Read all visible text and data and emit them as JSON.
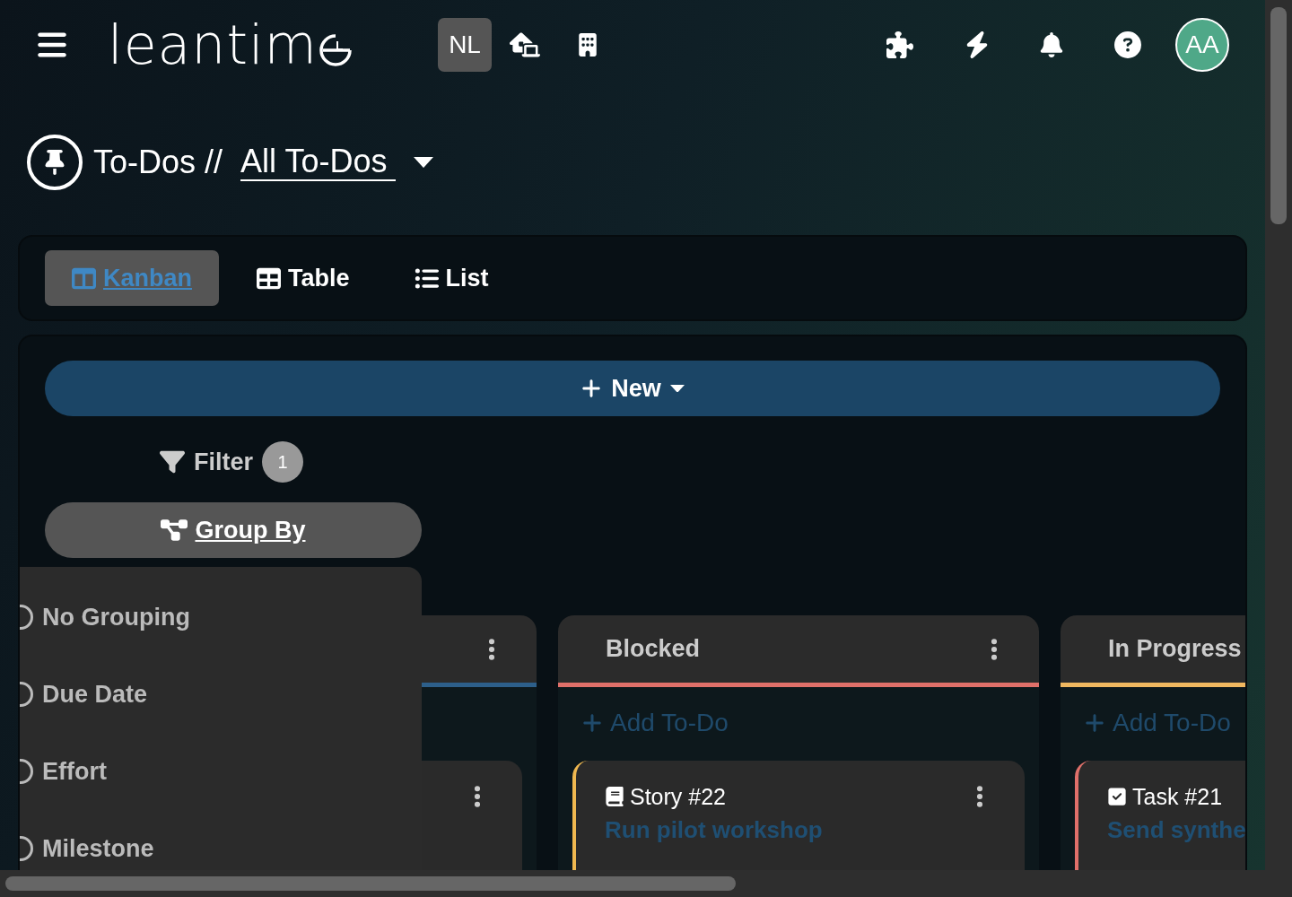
{
  "header": {
    "logo": "leantim",
    "workspace_badge": "NL",
    "avatar": "AA"
  },
  "breadcrumb": {
    "section": "To-Dos //",
    "view": "All To-Dos"
  },
  "view_tabs": [
    {
      "label": "Kanban",
      "kind": "kanban",
      "selected": true
    },
    {
      "label": "Table",
      "kind": "table",
      "selected": false
    },
    {
      "label": "List",
      "kind": "list",
      "selected": false
    }
  ],
  "new_button": "New",
  "filter": {
    "label": "Filter",
    "count": "1"
  },
  "group_by": {
    "label": "Group By",
    "options": [
      {
        "label": "No Grouping",
        "selected": false
      },
      {
        "label": "Due Date",
        "selected": false
      },
      {
        "label": "Effort",
        "selected": false
      },
      {
        "label": "Milestone",
        "selected": false
      }
    ]
  },
  "columns": [
    {
      "color": "#2d5f8a",
      "menu": true,
      "cards": [
        {
          "kind": "covered",
          "menu": true
        }
      ]
    },
    {
      "title": "Blocked",
      "color": "#e0706a",
      "menu": true,
      "add_label": "Add To-Do",
      "cards": [
        {
          "kind": "story",
          "id": "Story #22",
          "title": "Run pilot workshop",
          "color": "#f0b850",
          "menu": true
        }
      ]
    },
    {
      "title": "In Progress",
      "color": "#f0b860",
      "menu": false,
      "add_label": "Add To-Do",
      "cards": [
        {
          "kind": "task",
          "id": "Task #21",
          "title": "Send synthe",
          "color": "#e0706a",
          "menu": false
        }
      ]
    }
  ]
}
